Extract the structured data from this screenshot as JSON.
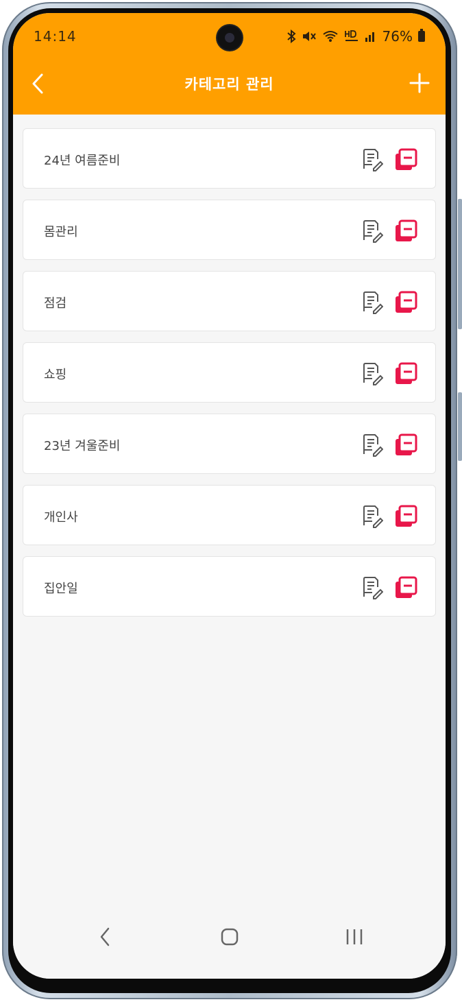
{
  "status_bar": {
    "time": "14:14",
    "battery": "76%",
    "icons": [
      "bluetooth-icon",
      "mute-icon",
      "wifi-icon",
      "hd-voice-icon",
      "signal-icon",
      "battery-icon"
    ]
  },
  "header": {
    "title": "카테고리 관리",
    "back_icon": "chevron-left-icon",
    "add_icon": "plus-icon",
    "background": "#ff9f00"
  },
  "categories": [
    {
      "label": "24년 여름준비"
    },
    {
      "label": "몸관리"
    },
    {
      "label": "점검"
    },
    {
      "label": "쇼핑"
    },
    {
      "label": "23년 겨울준비"
    },
    {
      "label": "개인사"
    },
    {
      "label": "집안일"
    }
  ],
  "row_actions": {
    "edit_icon": "edit-document-icon",
    "delete_icon": "delete-icon",
    "delete_color": "#e8174a"
  },
  "nav_bar": {
    "icons": [
      "back-icon",
      "home-icon",
      "recent-apps-icon"
    ]
  }
}
